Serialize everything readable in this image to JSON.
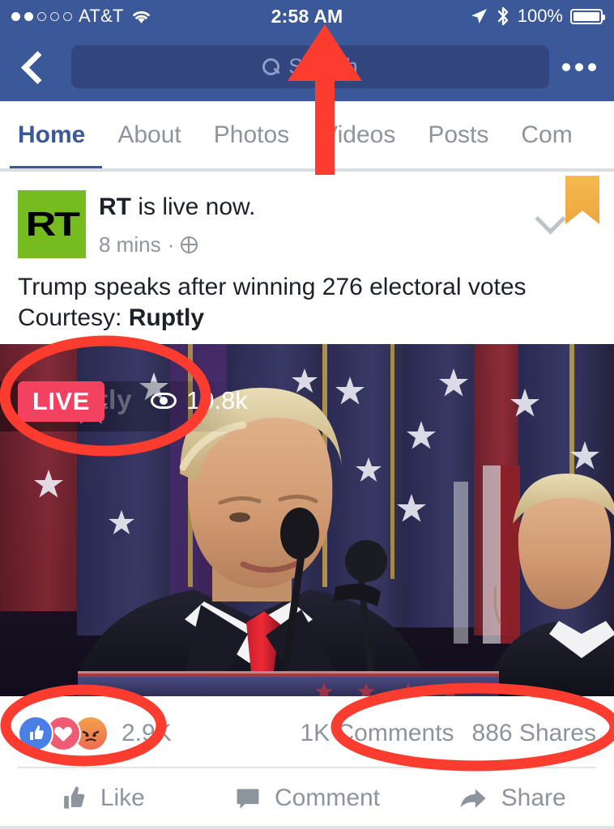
{
  "status_bar": {
    "carrier": "AT&T",
    "signal_filled": 2,
    "signal_total": 5,
    "wifi_icon": "wifi-icon",
    "time": "2:58 AM",
    "location_icon": "location-arrow-icon",
    "bluetooth_icon": "bluetooth-icon",
    "battery_percent": "100%"
  },
  "nav": {
    "back_icon": "back-chevron-icon",
    "search_icon": "search-icon",
    "search_value": "",
    "search_placeholder": "Search",
    "more_icon": "more-options-icon"
  },
  "tabs": [
    {
      "label": "Home",
      "active": true
    },
    {
      "label": "About",
      "active": false
    },
    {
      "label": "Photos",
      "active": false
    },
    {
      "label": "Videos",
      "active": false
    },
    {
      "label": "Posts",
      "active": false
    },
    {
      "label": "Com",
      "active": false
    }
  ],
  "post": {
    "avatar_text": "RT",
    "avatar_color": "#76bc21",
    "author": "RT",
    "title_suffix": " is live now.",
    "timestamp": "8 mins",
    "meta_separator": "·",
    "privacy_icon": "globe-icon",
    "chevron_icon": "chevron-down-icon",
    "bookmark_icon": "bookmark-saved-icon",
    "body_line1": "Trump speaks after winning  276 electoral votes",
    "body_line2_prefix": "Courtesy: ",
    "body_line2_bold": "Ruptly",
    "video": {
      "watermark": "Ruptly",
      "live_label": "LIVE",
      "viewers_icon": "eye-icon",
      "viewers_count": "10.8k"
    },
    "engagement": {
      "reactions": [
        "like-reaction-icon",
        "love-reaction-icon",
        "angry-reaction-icon"
      ],
      "reaction_count": "2.9K",
      "comments": "1K Comments",
      "shares": "886 Shares"
    },
    "actions": [
      {
        "icon": "thumbs-up-icon",
        "label": "Like"
      },
      {
        "icon": "comment-bubble-icon",
        "label": "Comment"
      },
      {
        "icon": "share-arrow-icon",
        "label": "Share"
      }
    ]
  },
  "annotations": {
    "arrow": {
      "name": "red-arrow-pointing-to-status-bar-time",
      "color": "#fc3c2e"
    },
    "ellipses": [
      {
        "name": "red-ellipse-around-live-badge",
        "color": "#fc3c2e"
      },
      {
        "name": "red-ellipse-around-reactions",
        "color": "#fc3c2e"
      },
      {
        "name": "red-ellipse-around-comments-shares",
        "color": "#fc3c2e"
      }
    ]
  },
  "colors": {
    "facebook_blue": "#3b5998",
    "search_field": "#32467d",
    "live_red": "#f3425f",
    "annotation_red": "#fc3c2e",
    "text_gray": "#8d949e",
    "text_dark": "#1d2129"
  }
}
